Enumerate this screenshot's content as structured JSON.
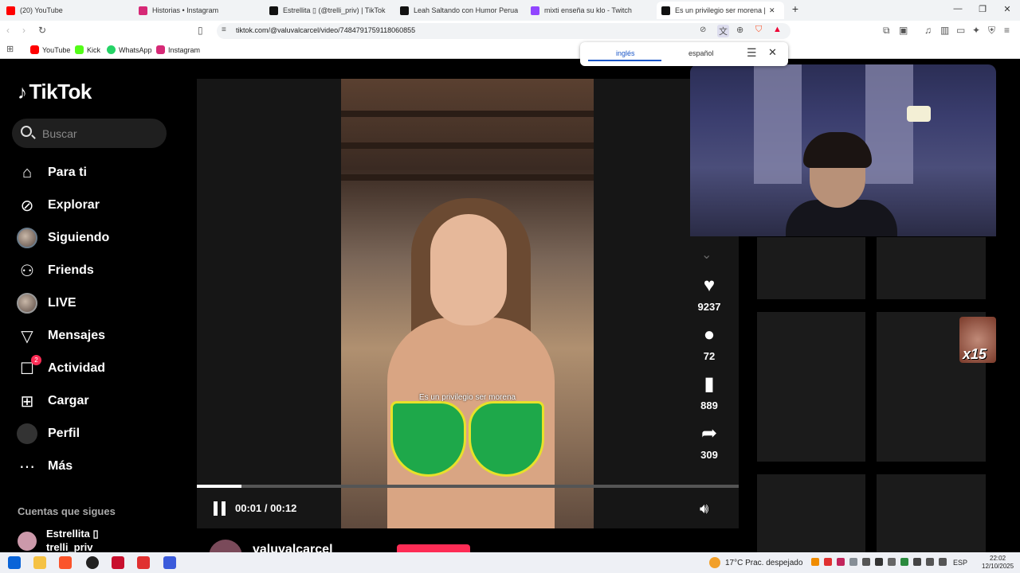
{
  "browser": {
    "tabs": [
      {
        "title": "(20) YouTube",
        "color": "#ff0000"
      },
      {
        "title": "Historias • Instagram",
        "color": "#d62976"
      },
      {
        "title": "Estrellita ▯ (@trelli_priv) | TikTok",
        "color": "#111111"
      },
      {
        "title": "Leah Saltando con Humor Peruano y",
        "color": "#111111"
      },
      {
        "title": "mixti enseña su klo - Twitch",
        "color": "#9146ff"
      },
      {
        "title": "Es un privilegio ser morena |",
        "color": "#111111"
      }
    ],
    "new_tab": "+",
    "controls": {
      "minimize": "—",
      "maximize": "❐",
      "close": "✕"
    },
    "url": "tiktok.com/@valuvalcarcel/video/7484791759118060855",
    "bookmarks": [
      {
        "label": "YouTube",
        "color": "#ff0000"
      },
      {
        "label": "Kick",
        "color": "#53fc18"
      },
      {
        "label": "WhatsApp",
        "color": "#25d366"
      },
      {
        "label": "Instagram",
        "color": "#d62976"
      }
    ]
  },
  "translate_popup": {
    "source_lang": "inglés",
    "target_lang": "español",
    "menu_icon": "☰",
    "close_icon": "✕"
  },
  "tiktok": {
    "logo": "TikTok",
    "search_placeholder": "Buscar",
    "nav": [
      {
        "label": "Para ti",
        "icon": "home-icon"
      },
      {
        "label": "Explorar",
        "icon": "compass-icon"
      },
      {
        "label": "Siguiendo",
        "icon": "avatar"
      },
      {
        "label": "Friends",
        "icon": "friends-icon"
      },
      {
        "label": "LIVE",
        "icon": "avatar"
      },
      {
        "label": "Mensajes",
        "icon": "send-icon"
      },
      {
        "label": "Actividad",
        "icon": "inbox-icon",
        "badge": "2"
      },
      {
        "label": "Cargar",
        "icon": "plus-square-icon"
      },
      {
        "label": "Perfil",
        "icon": "avatar"
      },
      {
        "label": "Más",
        "icon": "more-icon"
      }
    ],
    "following_title": "Cuentas que sigues",
    "following_account": {
      "name": "Estrellita ▯",
      "handle": "trelli_priv"
    }
  },
  "video": {
    "caption": "Es un privilegio ser morena",
    "progress": 0.083,
    "time": "00:01 / 00:12",
    "author": "valuvalcarcel",
    "actions": [
      {
        "icon": "heart-icon",
        "count": "9237"
      },
      {
        "icon": "comment-icon",
        "count": "72"
      },
      {
        "icon": "bookmark-icon",
        "count": "889"
      },
      {
        "icon": "share-icon",
        "count": "309"
      }
    ]
  },
  "overlay": {
    "sticker_text": "x15"
  },
  "taskbar": {
    "weather": "17°C  Prac. despejado",
    "language": "ESP",
    "time": "22:02",
    "date": "12/10/2025"
  }
}
